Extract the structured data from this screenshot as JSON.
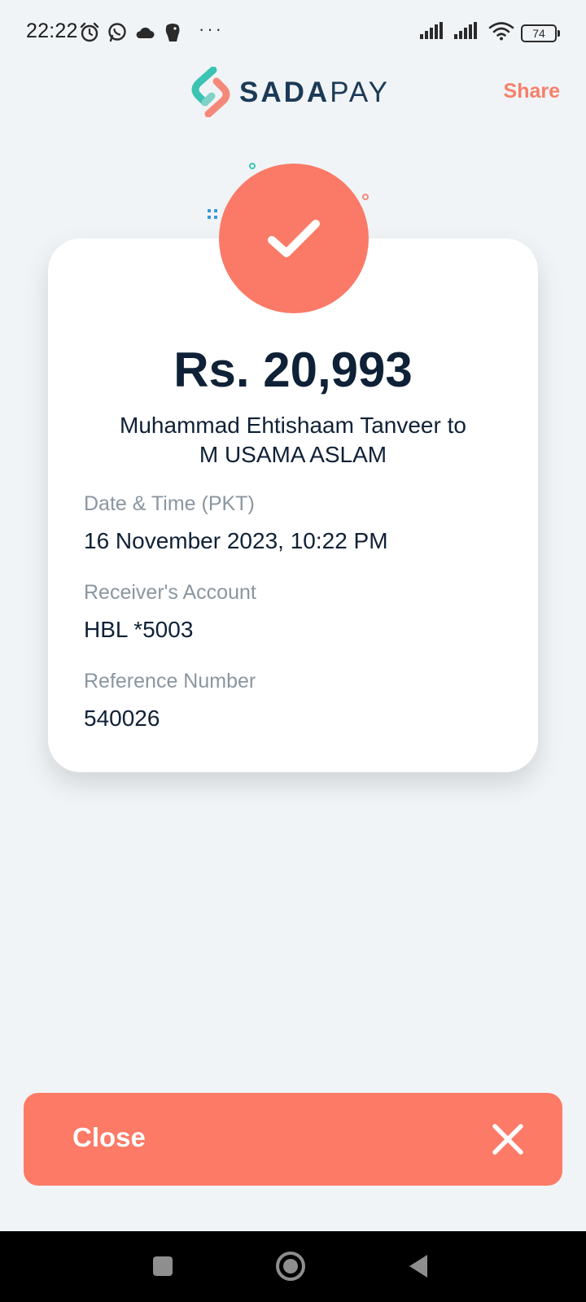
{
  "status_bar": {
    "time": "22:22",
    "battery": "74",
    "more": "···",
    "icons": [
      "alarm-icon",
      "whatsapp-icon",
      "cloud-icon",
      "lion-icon",
      "signal-icon",
      "signal-icon",
      "wifi-icon",
      "battery-icon"
    ]
  },
  "header": {
    "brand_bold": "SADA",
    "brand_light": "PAY",
    "share_label": "Share"
  },
  "receipt": {
    "amount": "Rs. 20,993",
    "sender": "Muhammad Ehtishaam Tanveer",
    "connector": "to",
    "receiver": "M USAMA ASLAM",
    "fields": [
      {
        "label": "Date & Time (PKT)",
        "value": "16 November 2023, 10:22 PM"
      },
      {
        "label": "Receiver's Account",
        "value": "HBL *5003"
      },
      {
        "label": "Reference Number",
        "value": "540026"
      }
    ]
  },
  "footer": {
    "close_label": "Close"
  },
  "nav": {
    "icons": [
      "recents-icon",
      "home-icon",
      "back-icon"
    ]
  },
  "colors": {
    "accent": "#fa7a67",
    "background": "#f1f4f6",
    "text_primary": "#0f2136",
    "text_muted": "#8a96a0",
    "brand_teal": "#3cc3b3"
  }
}
